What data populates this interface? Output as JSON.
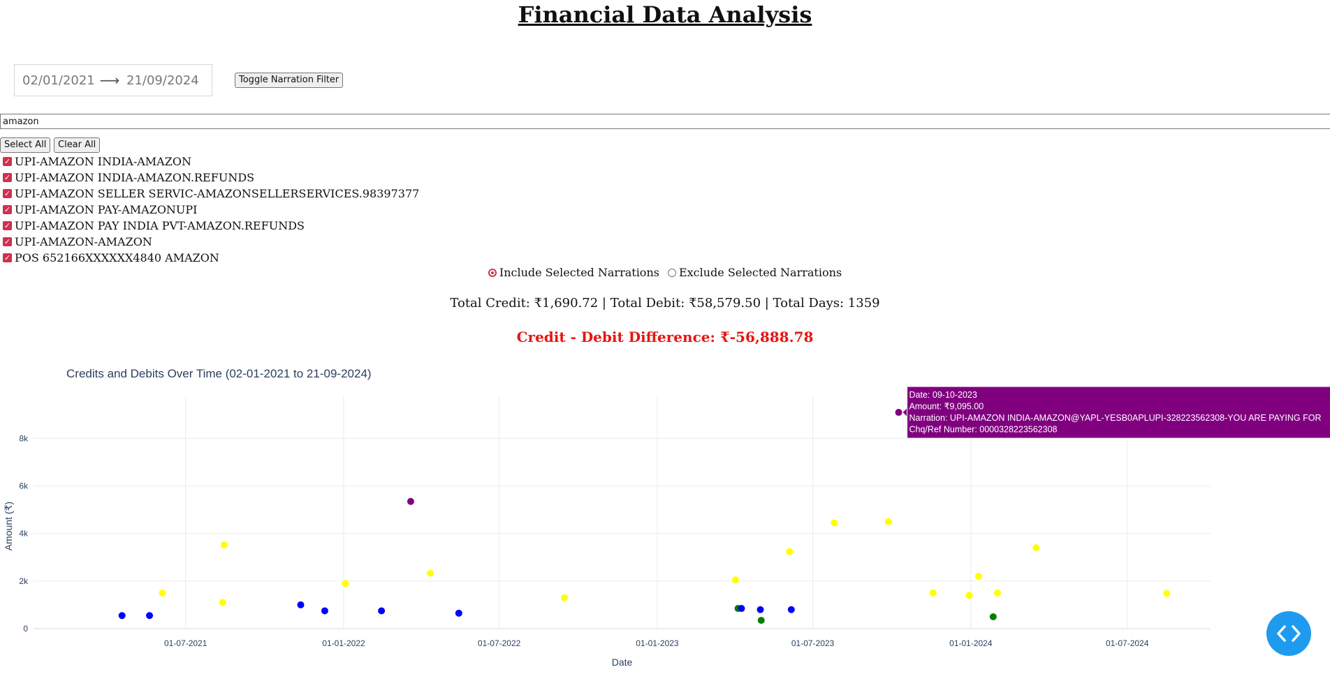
{
  "title": "Financial Data Analysis",
  "date_range": {
    "start": "02/01/2021",
    "end": "21/09/2024"
  },
  "toggle_button": "Toggle Narration Filter",
  "search": {
    "value": "amazon"
  },
  "select_all": "Select All",
  "clear_all": "Clear All",
  "narrations": [
    "UPI-AMAZON INDIA-AMAZON",
    "UPI-AMAZON INDIA-AMAZON.REFUNDS",
    "UPI-AMAZON SELLER SERVIC-AMAZONSELLERSERVICES.98397377",
    "UPI-AMAZON PAY-AMAZONUPI",
    "UPI-AMAZON PAY INDIA PVT-AMAZON.REFUNDS",
    "UPI-AMAZON-AMAZON",
    "POS 652166XXXXXX4840 AMAZON"
  ],
  "radio": {
    "include": "Include Selected Narrations",
    "exclude": "Exclude Selected Narrations",
    "selected": "include"
  },
  "totals": "Total Credit: ₹1,690.72 | Total Debit: ₹58,579.50 | Total Days: 1359",
  "difference": "Credit - Debit Difference: ₹-56,888.78",
  "chart_data": {
    "type": "scatter",
    "title": "Credits and Debits Over Time (02-01-2021 to 21-09-2024)",
    "xlabel": "Date",
    "ylabel": "Amount (₹)",
    "x_range": [
      "2021-01-05",
      "2024-10-06"
    ],
    "ylim": [
      0,
      9800
    ],
    "x_ticks": [
      {
        "date": "2021-07-01",
        "label": "01-07-2021"
      },
      {
        "date": "2022-01-01",
        "label": "01-01-2022"
      },
      {
        "date": "2022-07-01",
        "label": "01-07-2022"
      },
      {
        "date": "2023-01-01",
        "label": "01-01-2023"
      },
      {
        "date": "2023-07-01",
        "label": "01-07-2023"
      },
      {
        "date": "2024-01-01",
        "label": "01-01-2024"
      },
      {
        "date": "2024-07-01",
        "label": "01-07-2024"
      }
    ],
    "y_ticks": [
      {
        "value": 0,
        "label": "0"
      },
      {
        "value": 2000,
        "label": "2k"
      },
      {
        "value": 4000,
        "label": "4k"
      },
      {
        "value": 6000,
        "label": "6k"
      },
      {
        "value": 8000,
        "label": "8k"
      }
    ],
    "grid": true,
    "colors": {
      "yellow": "#ffff00",
      "blue": "#0000ff",
      "green": "#008000",
      "purple": "#800080"
    },
    "points": [
      {
        "date": "2021-04-18",
        "y": 550,
        "color": "blue"
      },
      {
        "date": "2021-06-04",
        "y": 1500,
        "color": "yellow"
      },
      {
        "date": "2021-05-20",
        "y": 550,
        "color": "blue"
      },
      {
        "date": "2021-08-13",
        "y": 1100,
        "color": "yellow"
      },
      {
        "date": "2021-08-15",
        "y": 3520,
        "color": "yellow"
      },
      {
        "date": "2021-11-12",
        "y": 1000,
        "color": "blue"
      },
      {
        "date": "2021-12-10",
        "y": 750,
        "color": "blue"
      },
      {
        "date": "2022-01-03",
        "y": 1900,
        "color": "yellow"
      },
      {
        "date": "2022-02-14",
        "y": 750,
        "color": "blue"
      },
      {
        "date": "2022-03-20",
        "y": 5350,
        "color": "purple"
      },
      {
        "date": "2022-04-12",
        "y": 2330,
        "color": "yellow"
      },
      {
        "date": "2022-05-15",
        "y": 650,
        "color": "blue"
      },
      {
        "date": "2022-09-15",
        "y": 1300,
        "color": "yellow"
      },
      {
        "date": "2023-04-02",
        "y": 2050,
        "color": "yellow"
      },
      {
        "date": "2023-04-05",
        "y": 850,
        "color": "green"
      },
      {
        "date": "2023-04-09",
        "y": 850,
        "color": "blue"
      },
      {
        "date": "2023-05-02",
        "y": 350,
        "color": "green"
      },
      {
        "date": "2023-05-01",
        "y": 800,
        "color": "blue"
      },
      {
        "date": "2023-06-04",
        "y": 3240,
        "color": "yellow"
      },
      {
        "date": "2023-06-06",
        "y": 800,
        "color": "blue"
      },
      {
        "date": "2023-07-26",
        "y": 4450,
        "color": "yellow"
      },
      {
        "date": "2023-09-27",
        "y": 4500,
        "color": "yellow"
      },
      {
        "date": "2023-10-09",
        "y": 9095,
        "color": "purple"
      },
      {
        "date": "2023-11-18",
        "y": 1500,
        "color": "yellow"
      },
      {
        "date": "2023-12-30",
        "y": 1400,
        "color": "yellow"
      },
      {
        "date": "2024-01-10",
        "y": 2200,
        "color": "yellow"
      },
      {
        "date": "2024-01-27",
        "y": 500,
        "color": "green"
      },
      {
        "date": "2024-02-01",
        "y": 1500,
        "color": "yellow"
      },
      {
        "date": "2024-03-17",
        "y": 3400,
        "color": "yellow"
      },
      {
        "date": "2024-08-16",
        "y": 1480,
        "color": "yellow"
      }
    ],
    "tooltip": {
      "point_index": 22,
      "color": "purple",
      "lines": [
        "Date: 09-10-2023",
        "Amount: ₹9,095.00",
        "Narration: UPI-AMAZON INDIA-AMAZON@YAPL-YESB0APLUPI-328223562308-YOU ARE PAYING FOR",
        "Chq/Ref Number: 0000328223562308"
      ]
    }
  },
  "fab": {
    "icon": "code-icon"
  }
}
